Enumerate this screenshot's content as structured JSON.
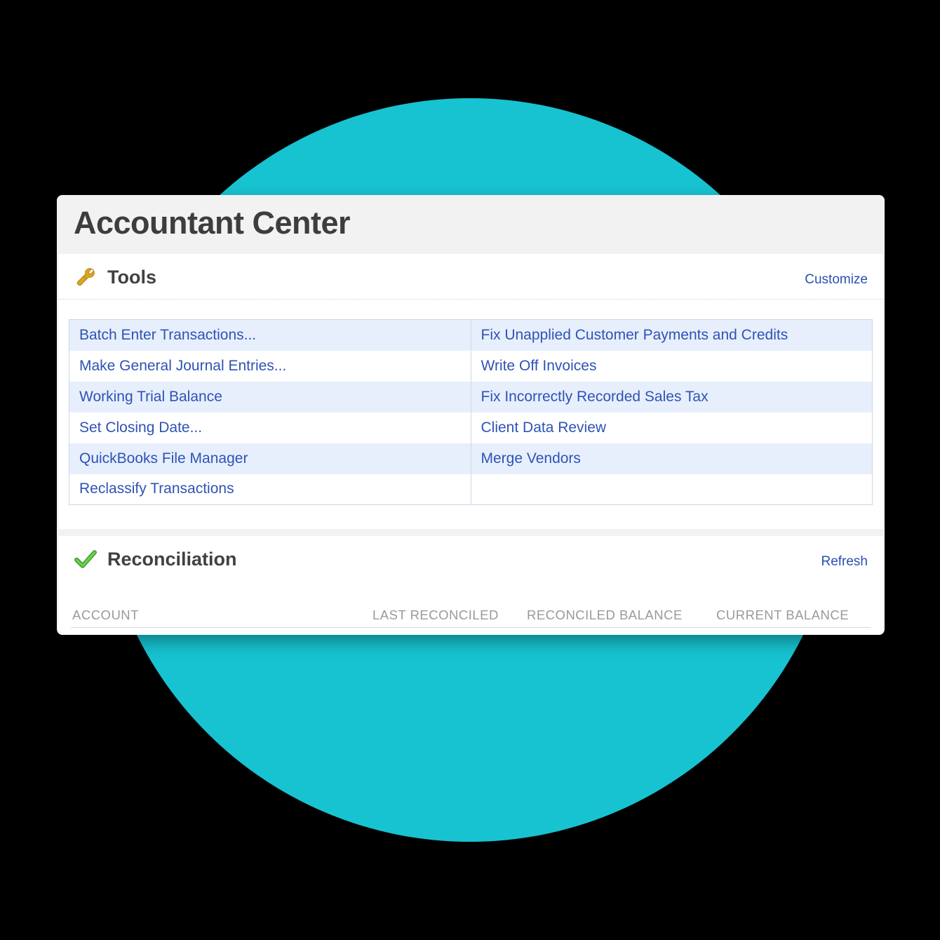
{
  "window": {
    "title": "Accountant Center"
  },
  "tools_panel": {
    "title": "Tools",
    "customize_link": "Customize",
    "left": [
      "Batch Enter Transactions...",
      "Make General Journal Entries...",
      "Working Trial Balance",
      "Set Closing Date...",
      "QuickBooks File Manager",
      "Reclassify Transactions"
    ],
    "right": [
      "Fix Unapplied Customer Payments and Credits",
      "Write Off Invoices",
      "Fix Incorrectly Recorded Sales Tax",
      "Client Data Review",
      "Merge Vendors",
      ""
    ]
  },
  "reconciliation_panel": {
    "title": "Reconciliation",
    "refresh_link": "Refresh",
    "columns": {
      "account": "ACCOUNT",
      "last_reconciled": "LAST RECONCILED",
      "reconciled_balance": "RECONCILED BALANCE",
      "current_balance": "CURRENT BALANCE"
    }
  },
  "colors": {
    "accent": "#17c3d1",
    "link": "#2f53b4",
    "row_alt": "#e7effd"
  }
}
